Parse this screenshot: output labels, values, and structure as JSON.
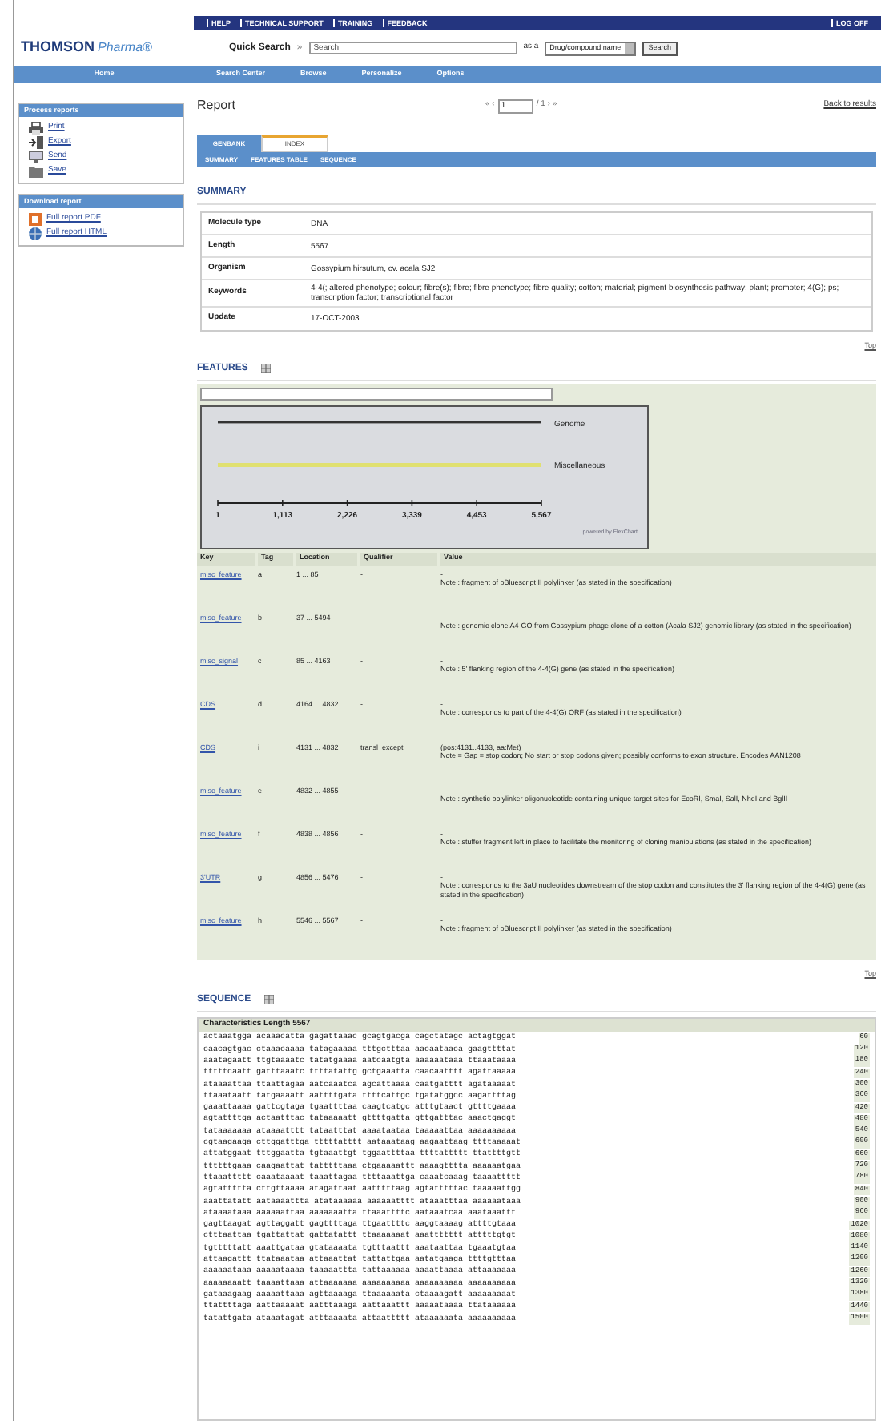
{
  "logo": {
    "brand": "THOMSON",
    "product": "Pharma®"
  },
  "top_links": [
    "HELP",
    "TECHNICAL SUPPORT",
    "TRAINING",
    "FEEDBACK"
  ],
  "logoff": "LOG OFF",
  "quick_search": {
    "label": "Quick Search",
    "arrow": "»",
    "placeholder": "Search",
    "as_label": "as a",
    "select_value": "Drug/compound name",
    "button": "Search"
  },
  "nav": [
    "Home",
    "Search Center",
    "Browse",
    "Personalize",
    "Options"
  ],
  "sidebar": [
    {
      "title": "Process reports",
      "items": [
        {
          "kind": "print",
          "label": "Print"
        },
        {
          "kind": "export",
          "label": "Export"
        },
        {
          "kind": "send",
          "label": "Send"
        },
        {
          "kind": "save",
          "label": "Save"
        }
      ]
    },
    {
      "title": "Download report",
      "items": [
        {
          "kind": "pdf",
          "label": "Full report PDF"
        },
        {
          "kind": "html",
          "label": "Full report HTML"
        }
      ]
    }
  ],
  "report": {
    "title": "Report",
    "pager_prev": "« ‹",
    "page": "1",
    "pager_next": "/ 1 › »",
    "back": "Back to results"
  },
  "tabs": [
    {
      "label": "GENBANK",
      "selected": false
    },
    {
      "label": "INDEX",
      "selected": true
    }
  ],
  "subnav": [
    "SUMMARY",
    "FEATURES TABLE",
    "SEQUENCE"
  ],
  "summary": {
    "heading": "SUMMARY",
    "rows": [
      {
        "label": "Molecule type",
        "value": "DNA"
      },
      {
        "label": "Length",
        "value": "5567"
      },
      {
        "label": "Organism",
        "value": "Gossypium hirsutum, cv. acala SJ2"
      },
      {
        "label": "Keywords",
        "value": "4-4(; altered phenotype; colour; fibre(s); fibre; fibre phenotype; fibre quality; cotton; material; pigment biosynthesis pathway; plant; promoter; 4(G); ps; transcription factor; transcriptional factor"
      },
      {
        "label": "Update",
        "value": "17-OCT-2003"
      }
    ],
    "top": "Top"
  },
  "features": {
    "heading": "FEATURES",
    "tracks": [
      {
        "label": "Genome",
        "color": "#333333"
      },
      {
        "label": "Miscellaneous",
        "color": "#e0e070"
      }
    ],
    "ticks": [
      "1",
      "1,113",
      "2,226",
      "3,339",
      "4,453",
      "5,567"
    ],
    "credit": "powered by FlexChart",
    "columns": [
      "Key",
      "Tag",
      "Location",
      "Qualifier",
      "Value"
    ],
    "rows": [
      {
        "key": "misc_feature",
        "tag": "a",
        "location": "1 ... 85",
        "qualifier": "-",
        "value": [
          "-",
          "Note : fragment of pBluescript II polylinker (as stated in the specification)"
        ]
      },
      {
        "key": "misc_feature",
        "tag": "b",
        "location": "37 ... 5494",
        "qualifier": "-",
        "value": [
          "-",
          "Note : genomic clone A4-GO from Gossypium phage clone of a cotton (Acala SJ2) genomic library (as stated in the specification)"
        ]
      },
      {
        "key": "misc_signal",
        "tag": "c",
        "location": "85 ... 4163",
        "qualifier": "-",
        "value": [
          "-",
          "Note : 5' flanking region of the 4-4(G) gene (as stated in the specification)"
        ]
      },
      {
        "key": "CDS",
        "tag": "d",
        "location": "4164 ... 4832",
        "qualifier": "-",
        "value": [
          "-",
          "Note : corresponds to part of the 4-4(G) ORF (as stated in the specification)"
        ]
      },
      {
        "key": "CDS",
        "tag": "i",
        "location": "4131 ... 4832",
        "qualifier": "transl_except",
        "value": [
          "(pos:4131..4133, aa:Met)",
          "Note = Gap = stop codon; No start or stop codons given; possibly conforms to exon structure. Encodes AAN1208"
        ]
      },
      {
        "key": "misc_feature",
        "tag": "e",
        "location": "4832 ... 4855",
        "qualifier": "-",
        "value": [
          "-",
          "Note : synthetic polylinker oligonucleotide containing unique target sites for EcoRI, SmaI, SalI, NheI and BglII"
        ]
      },
      {
        "key": "misc_feature",
        "tag": "f",
        "location": "4838 ... 4856",
        "qualifier": "-",
        "value": [
          "-",
          "Note : stuffer fragment left in place to facilitate the monitoring of cloning manipulations (as stated in the specification)"
        ]
      },
      {
        "key": "3'UTR",
        "tag": "g",
        "location": "4856 ... 5476",
        "qualifier": "-",
        "value": [
          "-",
          "Note : corresponds to the 3aU nucleotides downstream of the stop codon and constitutes the 3' flanking region of the 4-4(G) gene (as stated in the specification)"
        ]
      },
      {
        "key": "misc_feature",
        "tag": "h",
        "location": "5546 ... 5567",
        "qualifier": "-",
        "value": [
          "-",
          "Note : fragment of pBluescript II polylinker (as stated in the specification)"
        ]
      }
    ],
    "top": "Top"
  },
  "sequence": {
    "heading": "SEQUENCE",
    "title": "Characteristics Length 5567",
    "lines": [
      {
        "bases": "actaaatgga acaaacatta gagattaaac gcagtgacga cagctatagc actagtggat",
        "number": "60"
      },
      {
        "bases": "caacagtgac ctaaacaaaa tatagaaaaa tttgctttaa aacaataaca gaagttttat",
        "number": "120"
      },
      {
        "bases": "aaatagaatt ttgtaaaatc tatatgaaaa aatcaatgta aaaaaataaa ttaaataaaa",
        "number": "180"
      },
      {
        "bases": "tttttcaatt gatttaaatc ttttatattg gctgaaatta caacaatttt agattaaaaa",
        "number": "240"
      },
      {
        "bases": "ataaaattaa ttaattagaa aatcaaatca agcattaaaa caatgatttt agataaaaat",
        "number": "300"
      },
      {
        "bases": "ttaaataatt tatgaaaatt aattttgata ttttcattgc tgatatggcc aagattttag",
        "number": "360"
      },
      {
        "bases": "gaaattaaaa gattcgtaga tgaattttaa caagtcatgc atttgtaact gttttgaaaa",
        "number": "420"
      },
      {
        "bases": "agtattttga actaatttac tataaaaatt gttttgatta gttgatttac aaactgaggt",
        "number": "480"
      },
      {
        "bases": "tataaaaaaa ataaaatttt tataatttat aaaataataa taaaaattaa aaaaaaaaaa",
        "number": "540"
      },
      {
        "bases": "cgtaagaaga cttggatttga tttttatttt aataaataag aagaattaag ttttaaaaat",
        "number": "600"
      },
      {
        "bases": "attatggaat tttggaatta tgtaaattgt tggaattttaa ttttattttt ttattttgtt",
        "number": "660"
      },
      {
        "bases": "ttttttgaaa caagaattat tatttttaaa ctgaaaaattt aaaagtttta aaaaaatgaa",
        "number": "720"
      },
      {
        "bases": "ttaaattttt caaataaaat taaattagaa ttttaaattga caaatcaaag taaaattttt",
        "number": "780"
      },
      {
        "bases": "agtattttta cttgttaaaa atagattaat aatttttaag agtatttttac taaaaattgg",
        "number": "840"
      },
      {
        "bases": "aaattatatt aataaaattta atataaaaaa aaaaaatttt ataaatttaa aaaaaataaa",
        "number": "900"
      },
      {
        "bases": "ataaaataaa aaaaaattaa aaaaaaatta ttaaattttc aataaatcaa aaataaattt",
        "number": "960"
      },
      {
        "bases": "gagttaagat agttaggatt gagttttaga ttgaattttc aaggtaaaag attttgtaaa",
        "number": "1020"
      },
      {
        "bases": "ctttaattaa tgattattat gattatattt ttaaaaaaat aaattttttt atttttgtgt",
        "number": "1080"
      },
      {
        "bases": "tgtttttatt aaattgataa gtataaaata tgtttaattt aaataattaa tgaaatgtaa",
        "number": "1140"
      },
      {
        "bases": "attaagattt ttataaataa attaaattat tattattgaa aatatgaaga ttttgtttaa",
        "number": "1200"
      },
      {
        "bases": "aaaaaataaa aaaaataaaa taaaaattta tattaaaaaa aaaattaaaa attaaaaaaa",
        "number": "1260"
      },
      {
        "bases": "aaaaaaaatt taaaattaaa attaaaaaaa aaaaaaaaaa aaaaaaaaaa aaaaaaaaaa",
        "number": "1320"
      },
      {
        "bases": "gataaagaag aaaaattaaa agttaaaaga ttaaaaaata ctaaaagatt aaaaaaaaat",
        "number": "1380"
      },
      {
        "bases": "ttattttaga aattaaaaat aatttaaaga aattaaattt aaaaataaaa ttataaaaaa",
        "number": "1440"
      },
      {
        "bases": "tatattgata ataaatagat atttaaaata attaattttt ataaaaaata aaaaaaaaaa",
        "number": "1500"
      }
    ]
  }
}
